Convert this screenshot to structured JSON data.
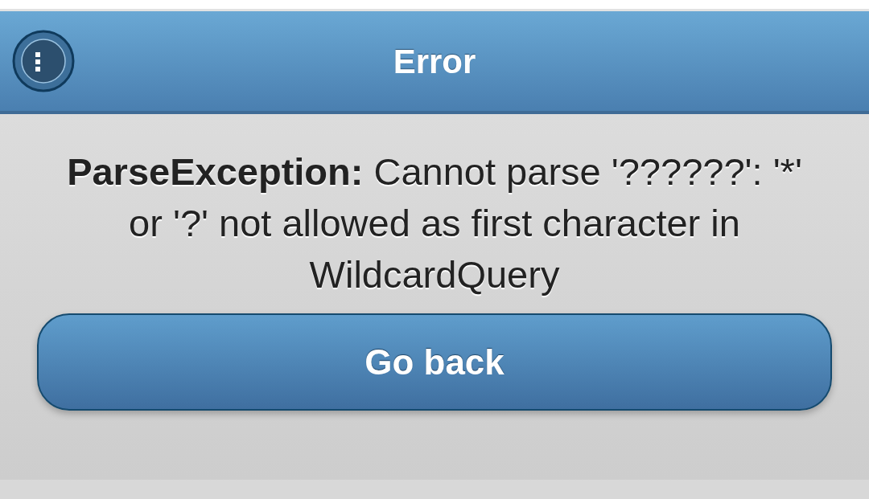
{
  "header": {
    "title": "Error"
  },
  "message": "**ParseException:** Cannot parse '??????': '*' or '?' not allowed as first character in WildcardQuery",
  "buttons": [
    {
      "label": "Go back"
    }
  ]
}
